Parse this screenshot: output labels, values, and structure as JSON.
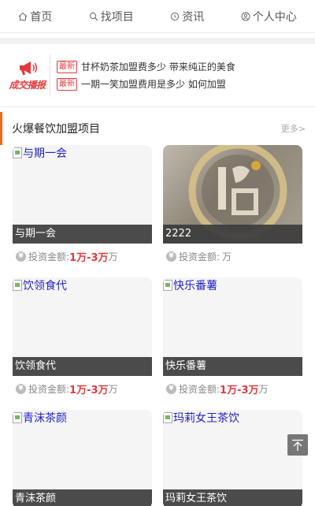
{
  "nav": [
    {
      "label": "首页",
      "icon": "home-icon"
    },
    {
      "label": "找项目",
      "icon": "search-icon"
    },
    {
      "label": "资讯",
      "icon": "history-icon"
    },
    {
      "label": "个人中心",
      "icon": "user-icon"
    }
  ],
  "news": {
    "logo_text": "成交播报",
    "tag": "最新",
    "items": [
      "甘杯奶茶加盟费多少 带来纯正的美食",
      "一期一笑加盟费用是多少 如何加盟"
    ]
  },
  "section": {
    "title": "火爆餐饮加盟项目",
    "more": "更多>"
  },
  "invest_label": "投资金额:",
  "unit": "万",
  "cards": [
    {
      "alt": "与期一会",
      "name": "与期一会",
      "amount": "1万-3万"
    },
    {
      "alt": "",
      "name": "2222",
      "amount": ""
    },
    {
      "alt": "饮领食代",
      "name": "饮领食代",
      "amount": "1万-3万"
    },
    {
      "alt": "快乐番薯",
      "name": "快乐番薯",
      "amount": "1万-3万"
    },
    {
      "alt": "青沫茶颜",
      "name": "青沫茶颜",
      "amount": ""
    },
    {
      "alt": "玛莉女王茶饮",
      "name": "玛莉女王茶饮",
      "amount": ""
    }
  ],
  "colors": {
    "accent": "#e4393c",
    "section_bar": "#f06a1e"
  }
}
